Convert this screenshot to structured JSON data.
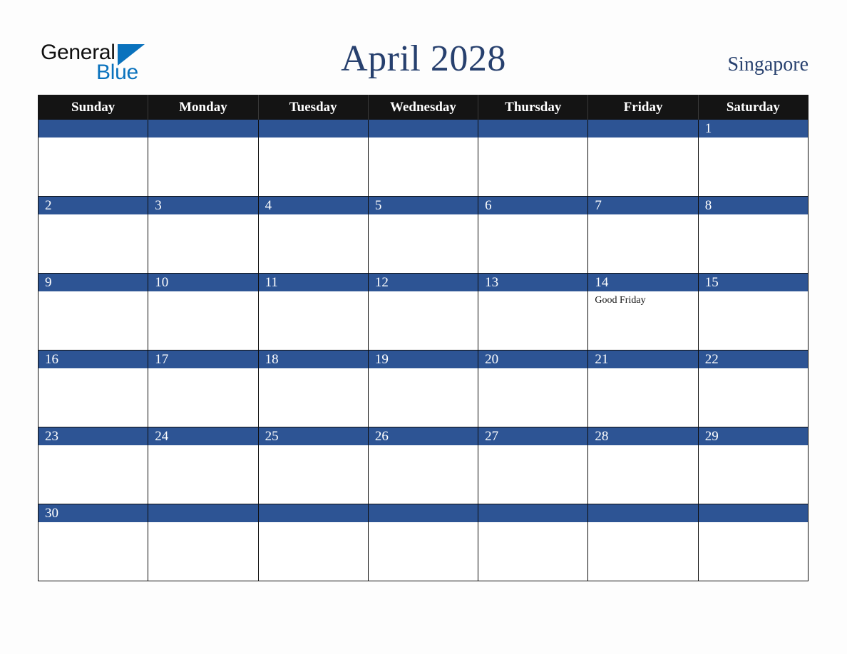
{
  "brand": {
    "name_part1": "General",
    "name_part2": "Blue",
    "triangle_icon": "triangle-icon",
    "color_dark": "#101010",
    "color_blue": "#0a72bd"
  },
  "header": {
    "title": "April 2028",
    "location": "Singapore",
    "title_color": "#27406e"
  },
  "calendar": {
    "weekdays": [
      "Sunday",
      "Monday",
      "Tuesday",
      "Wednesday",
      "Thursday",
      "Friday",
      "Saturday"
    ],
    "header_bg": "#141414",
    "date_bar_color": "#2d5494",
    "cell_bg": "#ffffff",
    "weeks": [
      [
        {
          "date": "",
          "events": []
        },
        {
          "date": "",
          "events": []
        },
        {
          "date": "",
          "events": []
        },
        {
          "date": "",
          "events": []
        },
        {
          "date": "",
          "events": []
        },
        {
          "date": "",
          "events": []
        },
        {
          "date": "1",
          "events": []
        }
      ],
      [
        {
          "date": "2",
          "events": []
        },
        {
          "date": "3",
          "events": []
        },
        {
          "date": "4",
          "events": []
        },
        {
          "date": "5",
          "events": []
        },
        {
          "date": "6",
          "events": []
        },
        {
          "date": "7",
          "events": []
        },
        {
          "date": "8",
          "events": []
        }
      ],
      [
        {
          "date": "9",
          "events": []
        },
        {
          "date": "10",
          "events": []
        },
        {
          "date": "11",
          "events": []
        },
        {
          "date": "12",
          "events": []
        },
        {
          "date": "13",
          "events": []
        },
        {
          "date": "14",
          "events": [
            "Good Friday"
          ]
        },
        {
          "date": "15",
          "events": []
        }
      ],
      [
        {
          "date": "16",
          "events": []
        },
        {
          "date": "17",
          "events": []
        },
        {
          "date": "18",
          "events": []
        },
        {
          "date": "19",
          "events": []
        },
        {
          "date": "20",
          "events": []
        },
        {
          "date": "21",
          "events": []
        },
        {
          "date": "22",
          "events": []
        }
      ],
      [
        {
          "date": "23",
          "events": []
        },
        {
          "date": "24",
          "events": []
        },
        {
          "date": "25",
          "events": []
        },
        {
          "date": "26",
          "events": []
        },
        {
          "date": "27",
          "events": []
        },
        {
          "date": "28",
          "events": []
        },
        {
          "date": "29",
          "events": []
        }
      ],
      [
        {
          "date": "30",
          "events": []
        },
        {
          "date": "",
          "events": []
        },
        {
          "date": "",
          "events": []
        },
        {
          "date": "",
          "events": []
        },
        {
          "date": "",
          "events": []
        },
        {
          "date": "",
          "events": []
        },
        {
          "date": "",
          "events": []
        }
      ]
    ]
  }
}
